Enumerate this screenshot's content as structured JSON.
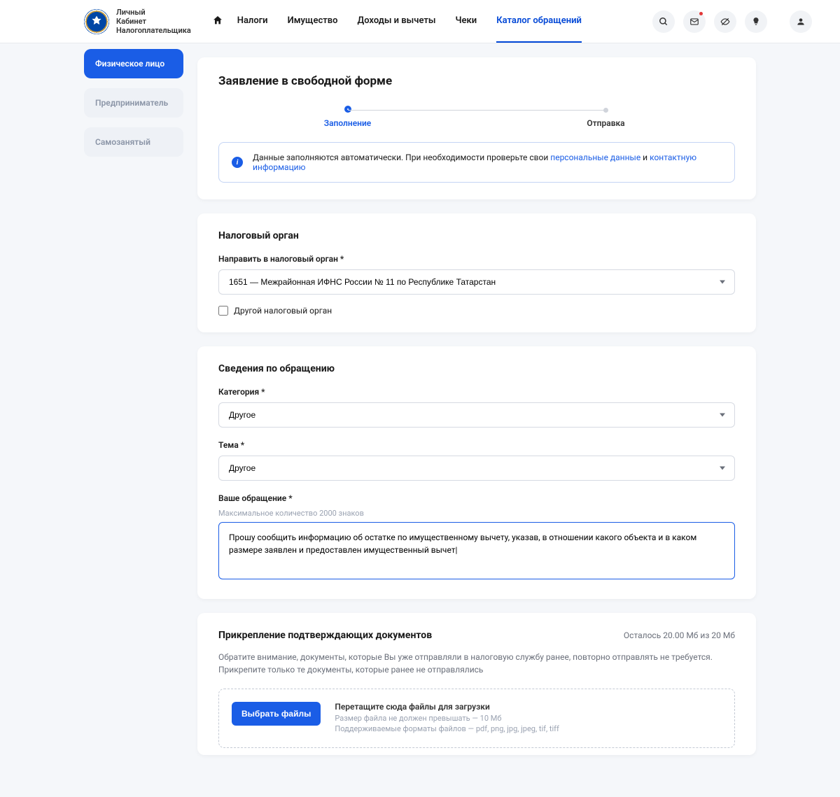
{
  "header": {
    "logo_line1": "Личный",
    "logo_line2": "Кабинет",
    "logo_line3": "Налогоплательщика",
    "nav": [
      "Налоги",
      "Имущество",
      "Доходы и вычеты",
      "Чеки",
      "Каталог обращений"
    ],
    "active_nav": 4
  },
  "sidebar": {
    "tabs": [
      "Физическое лицо",
      "Предприниматель",
      "Самозанятый"
    ],
    "active": 0
  },
  "form": {
    "title": "Заявление в свободной форме",
    "steps": [
      "Заполнение",
      "Отправка"
    ],
    "info_prefix": "Данные заполняются автоматически. При необходимости проверьте свои ",
    "info_link1": "персональные данные",
    "info_mid": " и ",
    "info_link2": "контактную информацию",
    "org_section": "Налоговый орган",
    "org_label": "Направить в налоговый орган *",
    "org_value": "1651 — Межрайонная ИФНС России № 11 по Республике Татарстан",
    "org_other_checkbox": "Другой налоговый орган",
    "details_section": "Сведения по обращению",
    "category_label": "Категория *",
    "category_value": "Другое",
    "topic_label": "Тема *",
    "topic_value": "Другое",
    "message_label": "Ваше обращение *",
    "message_hint": "Максимальное количество 2000 знаков",
    "message_value": "Прошу сообщить информацию об остатке по имущественному вычету, указав, в отношении какого объекта и в каком размере заявлен и предоставлен имущественный вычет|",
    "attach_section": "Прикрепление подтверждающих документов",
    "attach_remaining": "Осталось 20.00 Мб из 20 Мб",
    "attach_note": "Обратите внимание, документы, которые Вы уже отправляли в налоговую службу ранее, повторно отправлять не требуется. Прикрепите только те документы, которые ранее не отправлялись",
    "choose_files": "Выбрать файлы",
    "dz_title": "Перетащите сюда файлы для загрузки",
    "dz_size": "Размер файла не должен превышать — 10 Мб",
    "dz_formats": "Поддерживаемые форматы файлов — pdf, png, jpg, jpeg, tif, tiff"
  }
}
